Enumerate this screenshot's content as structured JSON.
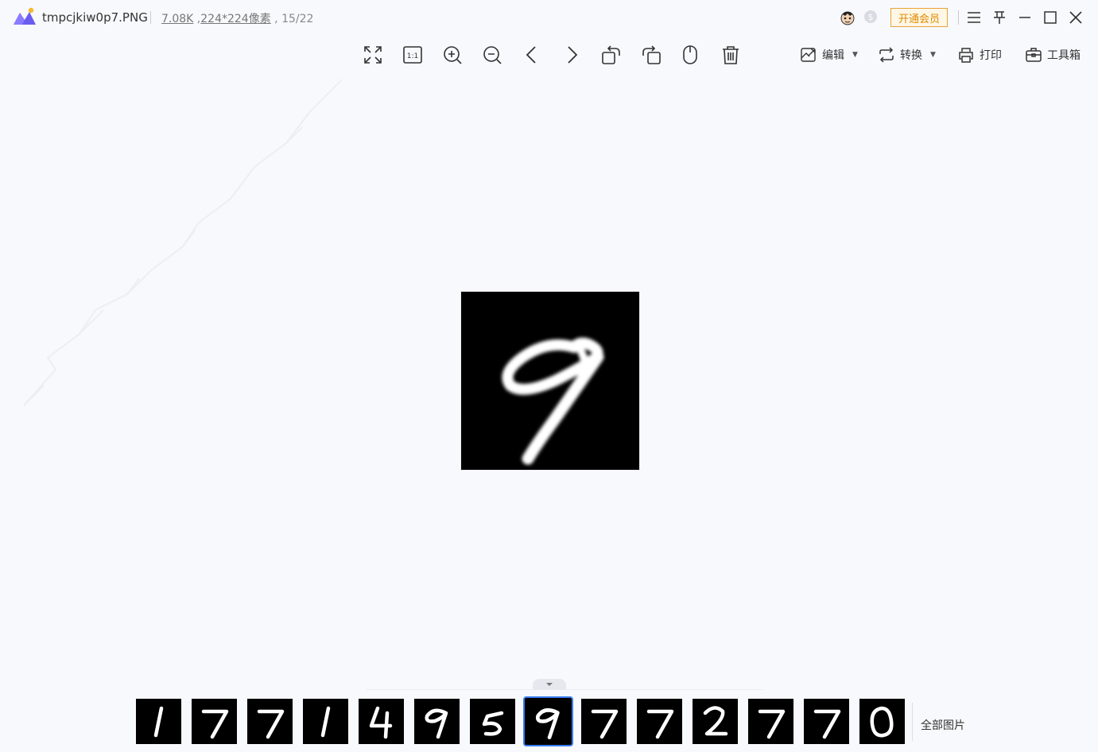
{
  "window": {
    "filename": "tmpcjkiw0p7.PNG",
    "file_size": "7.08K",
    "dimensions": "224*224像素",
    "counter": "15/22",
    "vip_label": "开通会员"
  },
  "icons": {
    "logo": "app-logo-icon",
    "avatar": "user-avatar-icon",
    "coin": "coin-icon",
    "menu": "menu-icon",
    "pin": "pin-icon",
    "minimize": "minimize-icon",
    "maximize": "maximize-icon",
    "close": "close-icon"
  },
  "toolbar": {
    "tools": [
      "fullscreen-icon",
      "actual-size-icon",
      "zoom-in-icon",
      "zoom-out-icon",
      "prev-icon",
      "next-icon",
      "rotate-left-icon",
      "rotate-right-icon",
      "mouse-icon",
      "delete-icon"
    ],
    "actual_size_glyph": "1:1",
    "edit_label": "编辑",
    "convert_label": "转换",
    "print_label": "打印",
    "toolbox_label": "工具箱"
  },
  "viewer": {
    "image_digit": "9"
  },
  "filmstrip": {
    "digits": [
      "1",
      "7",
      "7",
      "1",
      "4",
      "9",
      "5",
      "9",
      "7",
      "7",
      "2",
      "7",
      "7",
      "0"
    ],
    "active_index": 7,
    "all_images_label": "全部图片"
  },
  "colors": {
    "background": "#f8f9fc",
    "accent": "#3b7cf0",
    "vip": "#e08a00"
  }
}
